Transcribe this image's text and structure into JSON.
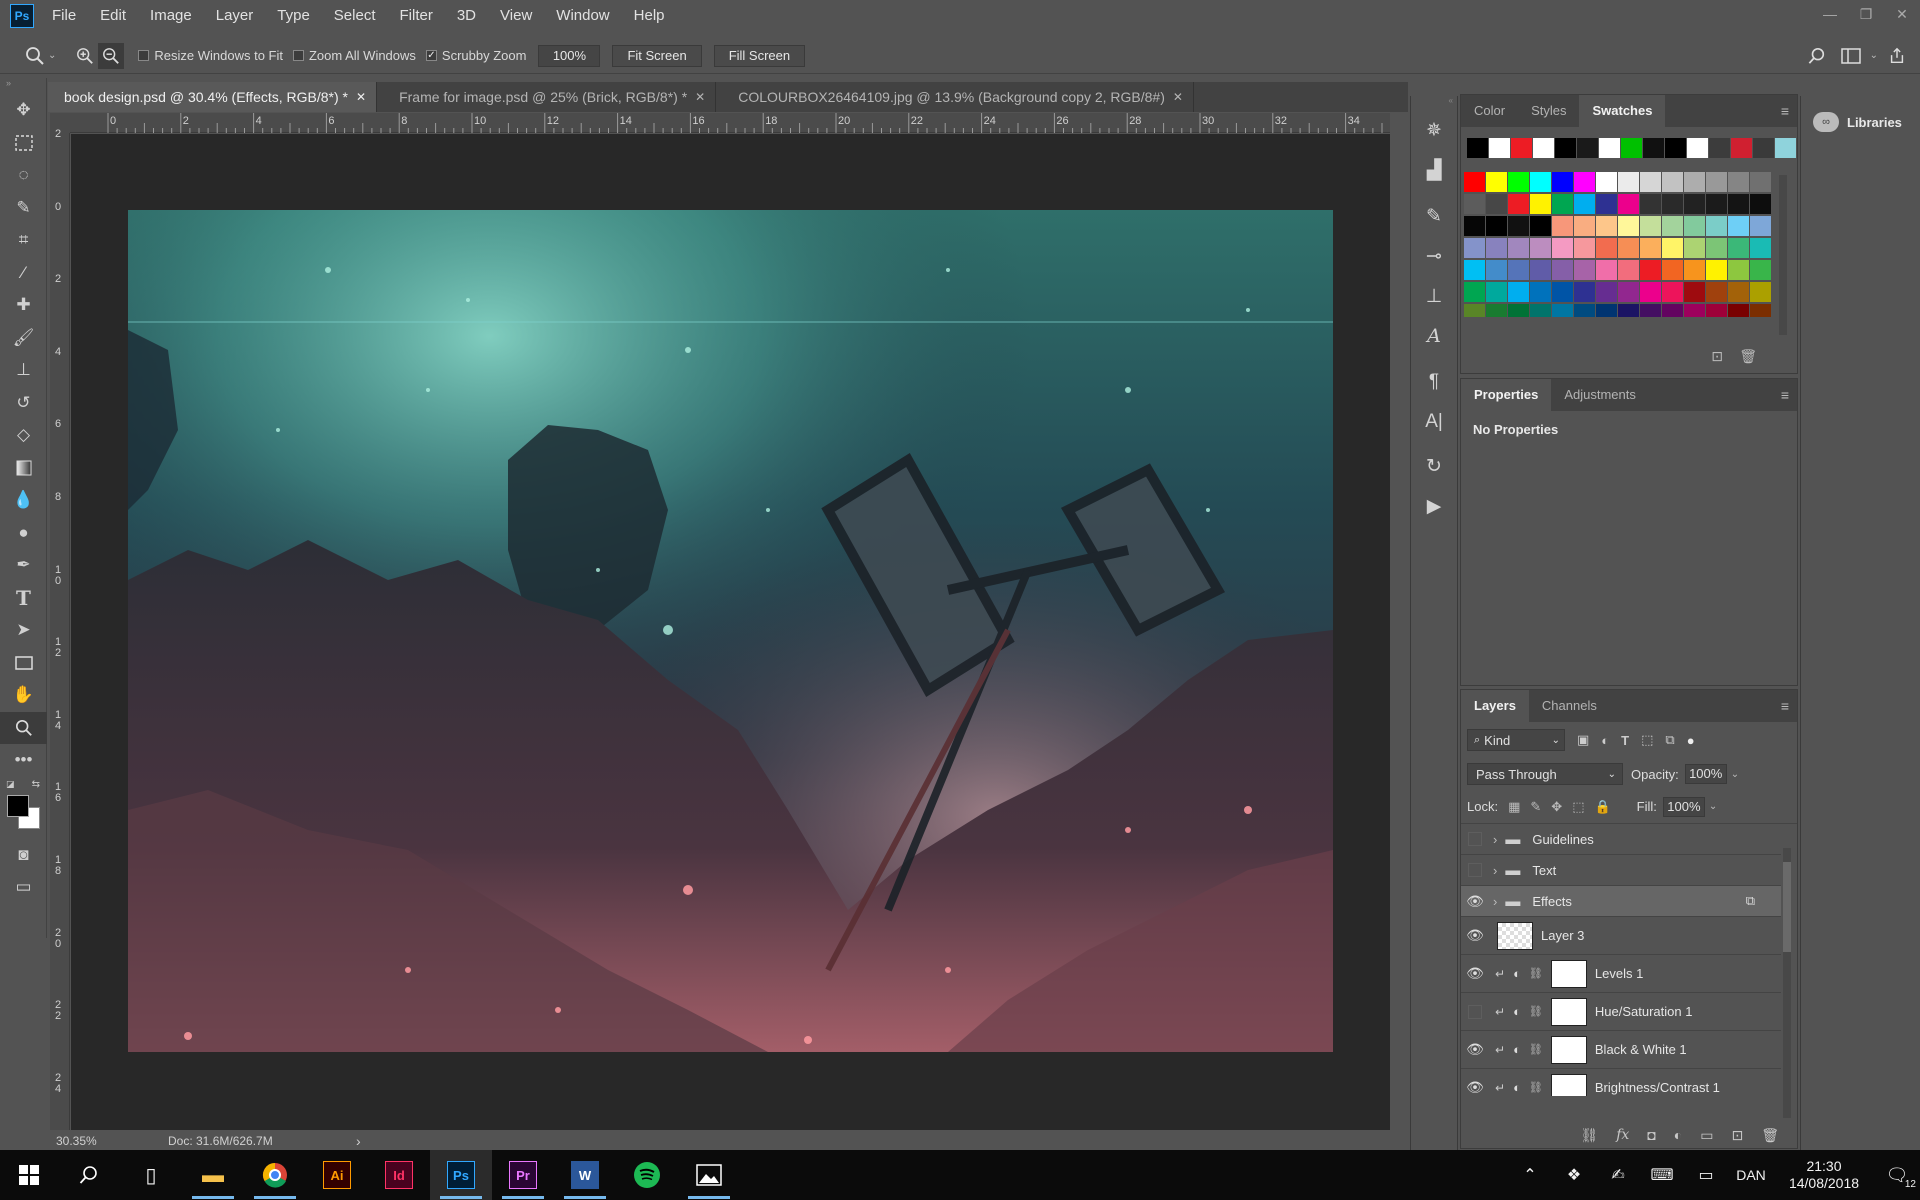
{
  "app": {
    "logo": "Ps"
  },
  "menu": [
    "File",
    "Edit",
    "Image",
    "Layer",
    "Type",
    "Select",
    "Filter",
    "3D",
    "View",
    "Window",
    "Help"
  ],
  "window_controls": {
    "minimize": "—",
    "restore": "❐",
    "close": "✕"
  },
  "options": {
    "resize_windows": "Resize Windows to Fit",
    "zoom_all": "Zoom All Windows",
    "scrubby_zoom": "Scrubby Zoom",
    "zoom_value": "100%",
    "fit_screen": "Fit Screen",
    "fill_screen": "Fill Screen"
  },
  "tabs": [
    {
      "label": "book design.psd @ 30.4% (Effects, RGB/8*) *",
      "close": "✕"
    },
    {
      "label": "Frame for image.psd @ 25% (Brick, RGB/8*) *",
      "close": "✕"
    },
    {
      "label": "COLOURBOX26464109.jpg @ 13.9% (Background copy 2, RGB/8#)",
      "close": "✕"
    }
  ],
  "ruler_top": [
    "0",
    "2",
    "4",
    "6",
    "8",
    "10",
    "12",
    "14",
    "16",
    "18",
    "20",
    "22",
    "24",
    "26",
    "28",
    "30",
    "32",
    "34"
  ],
  "ruler_left": [
    "2",
    "0",
    "2",
    "4",
    "6",
    "8",
    "1\n0",
    "1\n2",
    "1\n4",
    "1\n6",
    "1\n8",
    "2\n0",
    "2\n2",
    "2\n4"
  ],
  "status": {
    "zoom": "30.35%",
    "doc": "Doc: 31.6M/626.7M",
    "arrow": "›"
  },
  "swatches_panel": {
    "tabs": [
      "Color",
      "Styles",
      "Swatches"
    ]
  },
  "swatch_colors": {
    "recent": [
      "#000000",
      "#ffffff",
      "#ed1c24",
      "#ffffff",
      "#000000",
      "#1a1a1a",
      "#ffffff",
      "#00c000",
      "#111111",
      "#000000",
      "#ffffff",
      "#3c3c3c",
      "#d02030",
      "#3a3a3a",
      "#8fd3dc"
    ],
    "rows": [
      [
        "#ff0000",
        "#ffff00",
        "#00ff00",
        "#00ffff",
        "#0000ff",
        "#ff00ff",
        "#ffffff",
        "#ebebeb",
        "#d6d6d6",
        "#c2c2c2",
        "#adadad",
        "#999999",
        "#858585",
        "#707070"
      ],
      [
        "#5c5c5c",
        "#474747",
        "#ed1c24",
        "#fff200",
        "#00a651",
        "#00aeef",
        "#2e3192",
        "#ec008c",
        "#333333",
        "#2a2a2a",
        "#222222",
        "#1b1b1b",
        "#141414",
        "#0d0d0d"
      ],
      [
        "#060606",
        "#000000",
        "#111111",
        "#000000",
        "#f7977a",
        "#f9ad81",
        "#fdc68a",
        "#fff79a",
        "#c4df9b",
        "#a3d39c",
        "#82ca9d",
        "#7bcdc8",
        "#6ecff6",
        "#7ea7d8"
      ],
      [
        "#8493ca",
        "#8882be",
        "#a187be",
        "#bc8dbf",
        "#f49ac2",
        "#f6989d",
        "#f26c4f",
        "#f68e55",
        "#fbaf5c",
        "#fff467",
        "#acd372",
        "#7cc576",
        "#3bb878",
        "#1abbb4"
      ],
      [
        "#00bff3",
        "#438cca",
        "#5574b9",
        "#605ca8",
        "#855fa8",
        "#a763a8",
        "#f06ea9",
        "#f26d7d",
        "#ed1c24",
        "#f26522",
        "#f7941d",
        "#fff200",
        "#8dc73f",
        "#39b54a"
      ],
      [
        "#00a651",
        "#00a99d",
        "#00aeef",
        "#0072bc",
        "#0054a6",
        "#2e3192",
        "#662d91",
        "#92278f",
        "#ec008c",
        "#ed145b",
        "#9e0b0f",
        "#a0410d",
        "#a36209",
        "#aba000"
      ],
      [
        "#598527",
        "#197b30",
        "#007236",
        "#00746b",
        "#0076a3",
        "#004b80",
        "#003471",
        "#1b1464",
        "#440e62",
        "#630460",
        "#9e005d",
        "#9e0039",
        "#790000",
        "#7b2e00"
      ]
    ]
  },
  "properties_panel": {
    "tabs": [
      "Properties",
      "Adjustments"
    ],
    "content": "No Properties"
  },
  "libraries": {
    "label": "Libraries"
  },
  "layers_panel": {
    "tabs": [
      "Layers",
      "Channels"
    ],
    "kind": "Kind",
    "blend": "Pass Through",
    "opacity_label": "Opacity:",
    "opacity": "100%",
    "lock_label": "Lock:",
    "fill_label": "Fill:",
    "fill": "100%",
    "layers": [
      {
        "name": "Guidelines",
        "type": "group",
        "visible": false
      },
      {
        "name": "Text",
        "type": "group",
        "visible": false
      },
      {
        "name": "Effects",
        "type": "group",
        "visible": true,
        "selected": true
      },
      {
        "name": "Layer 3",
        "type": "pixel",
        "visible": true
      },
      {
        "name": "Levels 1",
        "type": "adjustment",
        "visible": true
      },
      {
        "name": "Hue/Saturation 1",
        "type": "adjustment",
        "visible": false
      },
      {
        "name": "Black & White 1",
        "type": "adjustment",
        "visible": true
      },
      {
        "name": "Brightness/Contrast 1",
        "type": "adjustment",
        "visible": true
      }
    ]
  },
  "tray": {
    "language": "DAN",
    "time": "21:30",
    "date": "14/08/2018",
    "notifications": "12"
  }
}
